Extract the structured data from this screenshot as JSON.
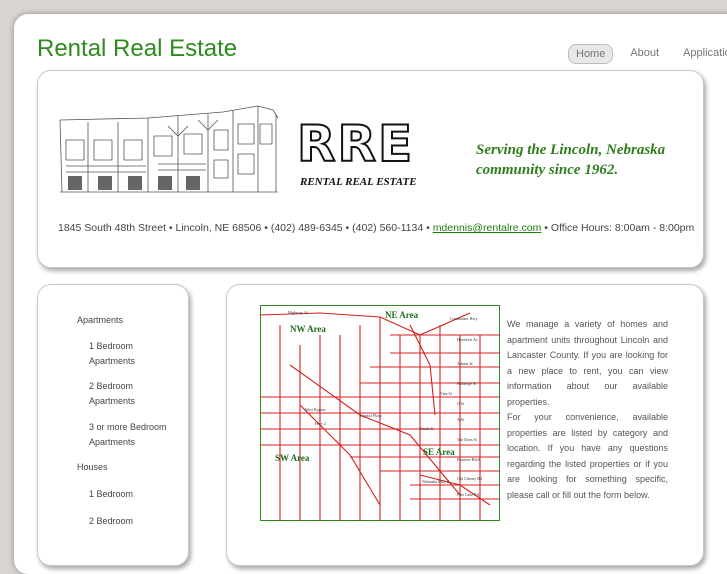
{
  "header": {
    "site_title": "Rental Real Estate",
    "nav": [
      "Home",
      "About",
      "Application"
    ],
    "active_nav": "Home"
  },
  "banner": {
    "logo_letters": "RRE",
    "logo_subtitle": "RENTAL REAL ESTATE",
    "tagline_line1": "Serving the Lincoln, Nebraska",
    "tagline_line2": "community since 1962.",
    "contact_before_email": "1845 South 48th Street • Lincoln, NE  68506 • (402) 489-6345 • (402) 560-1134 • ",
    "email": "mdennis@rentalre.com",
    "contact_after_email": " • Office Hours: 8:00am - 8:00pm"
  },
  "sidebar": {
    "apartments": "Apartments",
    "apt_1br_a": "1 Bedroom",
    "apt_1br_b": "Apartments",
    "apt_2br_a": "2 Bedroom",
    "apt_2br_b": "Apartments",
    "apt_3br_a": "3 or more Bedroom",
    "apt_3br_b": "Apartments",
    "houses": "Houses",
    "house_1br": "1 Bedroom",
    "house_2br": "2 Bedroom"
  },
  "map": {
    "areas": [
      "NE Area",
      "NW Area",
      "SW Area",
      "SE Area"
    ],
    "streets": [
      "Highway 34",
      "Cornhusker Hwy",
      "Havelock Av",
      "Adams St",
      "Holdrege St",
      "Vine St",
      "O St",
      "A St",
      "South St",
      "Van Dorn St",
      "Pioneers Blvd",
      "Old Cheney Rd",
      "Pine Lake Rd",
      "Capitol Pkwy",
      "West Bypass",
      "Hwy 2",
      "Nebraska Hwy 2"
    ],
    "colors": {
      "roads": "#d42020",
      "areas": "#1f6e1f",
      "border": "#2e8b1e"
    }
  },
  "content": {
    "para1": "We manage a variety of homes and apartment units throughout Lincoln and Lancaster County. If you are looking for a new place to rent, you can view information about our available properties.",
    "para2": "For your convenience, available properties are listed by category and location. If you have any questions regarding the listed properties or if you are looking for something specific, please call or fill out the form below."
  },
  "colors": {
    "brand_green": "#2e8b1e",
    "tagline_green": "#2e7d1a"
  }
}
